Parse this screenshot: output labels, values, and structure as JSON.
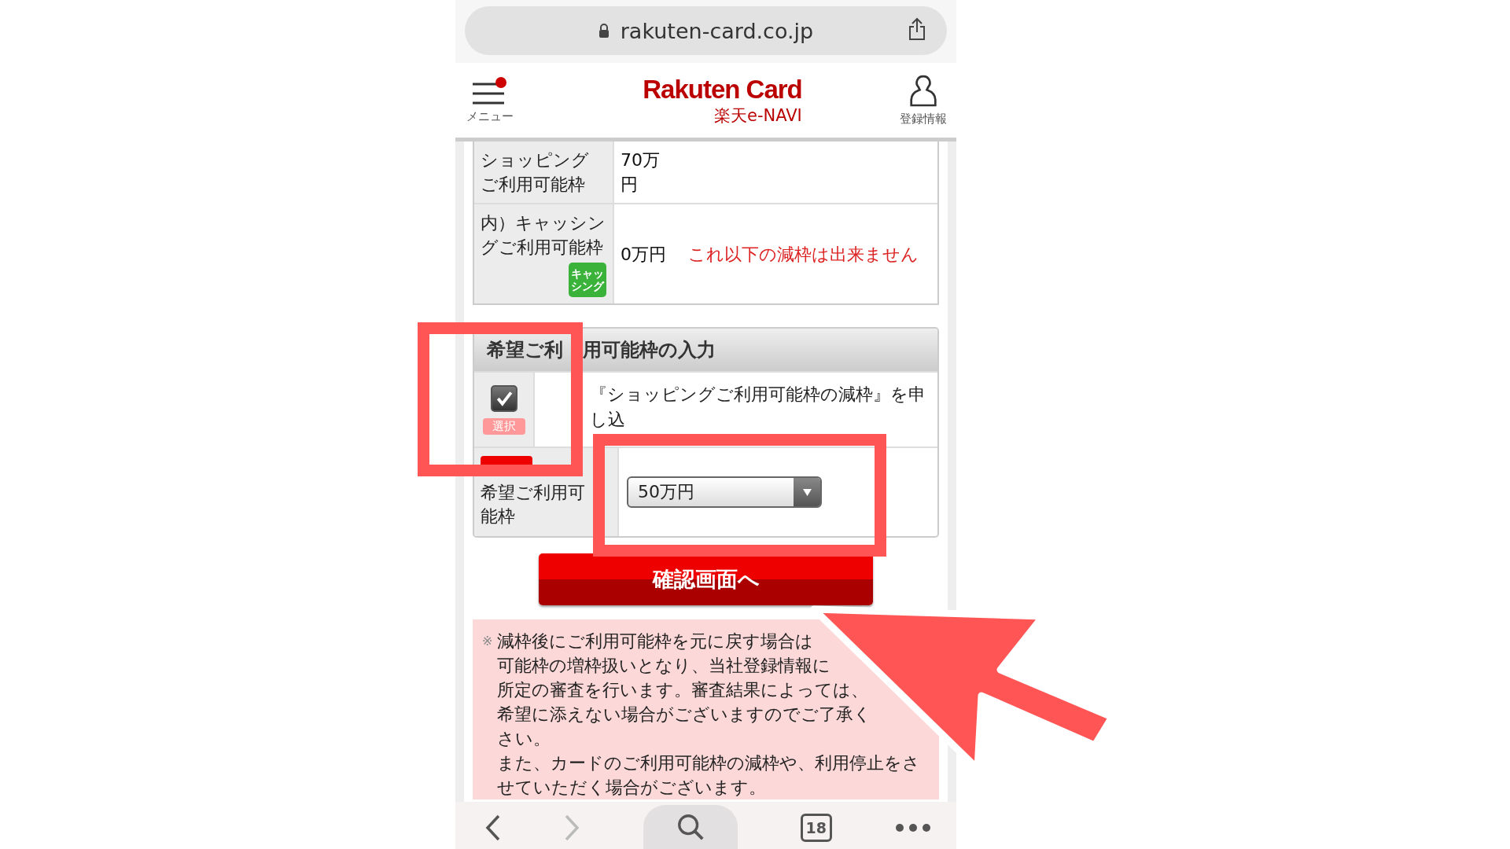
{
  "browser": {
    "url": "rakuten-card.co.jp",
    "tab_count": "18"
  },
  "header": {
    "menu_label": "メニュー",
    "logo": "Rakuten Card",
    "subtitle": "楽天e-NAVI",
    "account_label": "登録情報"
  },
  "limits_table": {
    "rows": [
      {
        "label": "ショッピングご利用可能枠",
        "value": "70万円"
      },
      {
        "label": "内）キャッシングご利用可能枠",
        "badge": "キャッシング",
        "value": "0万円",
        "warning": "これ以下の減枠は出来ません"
      }
    ]
  },
  "input_panel": {
    "title": [
      "希望ご利",
      "用可能枠の入力"
    ],
    "checkbox": {
      "checked": true,
      "tag": "選択",
      "label": "『ショッピングご利用可能枠の減枠』を申し込"
    },
    "limit_field": {
      "label": "希望ご利用可能枠",
      "value": "50万円"
    }
  },
  "confirm_button": "確認画面へ",
  "notice": {
    "mark": "※",
    "lines": [
      "減枠後にご利用可能枠を元に戻す場合は",
      "可能枠の増枠扱いとなり、当社登録情報に",
      "所定の審査を行います。審査結果によっては、",
      "希望に添えない場合がございますのでご了承く",
      "さい。"
    ],
    "paragraph": "また、カードのご利用可能枠の減枠や、利用停止をさせていただく場合がございます。"
  }
}
